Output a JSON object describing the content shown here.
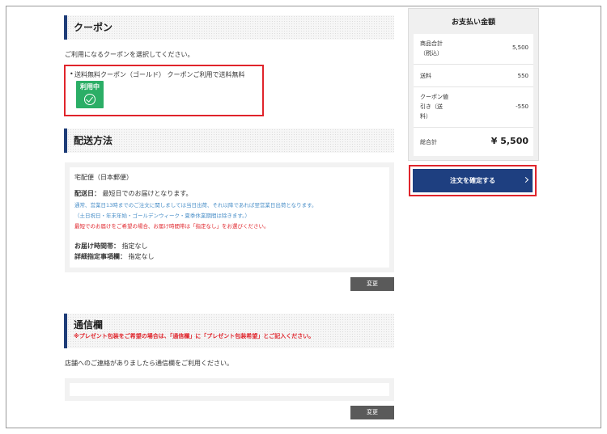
{
  "coupon": {
    "heading": "クーポン",
    "instruction": "ご利用になるクーポンを選択してください。",
    "item": "送料無料クーポン（ゴールド） クーポンご利用で送料無料",
    "badge_label": "利用中",
    "badge_icon": "check-circle-icon"
  },
  "shipping": {
    "heading": "配送方法",
    "method": "宅配便（日本郵便）",
    "delivery_label": "配送日：",
    "delivery_value": "最短日でのお届けとなります。",
    "note1": "通常、営業日13時までのご注文に関しましては当日出荷、それ以降であれば翌営業日出荷となります。",
    "note2": "（土日祝日・年末年始・ゴールデンウィーク・夏季休業期間は除きます。）",
    "note3": "最短でのお届けをご希望の場合、お届け時間帯は「指定なし」をお選びください。",
    "time_label": "お届け時間帯：",
    "time_value": "指定なし",
    "detail_label": "詳細指定事項欄：",
    "detail_value": "指定なし",
    "change_label": "変更"
  },
  "message": {
    "heading": "通信欄",
    "warning": "※プレゼント包装をご希望の場合は、「通信欄」に「プレゼント包装希望」とご記入ください。",
    "description": "店舗へのご連絡がありましたら通信欄をご利用ください。",
    "input_value": "",
    "change_label": "変更"
  },
  "summary": {
    "title": "お支払い金額",
    "subtotal_label_1": "商品合計",
    "subtotal_label_2": "（税込）",
    "subtotal_value": "5,500",
    "shipping_label": "送料",
    "shipping_value": "550",
    "coupon_label_1": "クーポン値",
    "coupon_label_2": "引き（送",
    "coupon_label_3": "料）",
    "coupon_value": "-550",
    "total_label": "総合計",
    "total_value": "¥ 5,500",
    "confirm_label": "注文を確定する"
  },
  "colors": {
    "accent": "#1f3d78",
    "highlight": "#e0242b",
    "badge": "#2bae66",
    "note_blue": "#4a8fc8",
    "note_red": "#e0242b"
  }
}
